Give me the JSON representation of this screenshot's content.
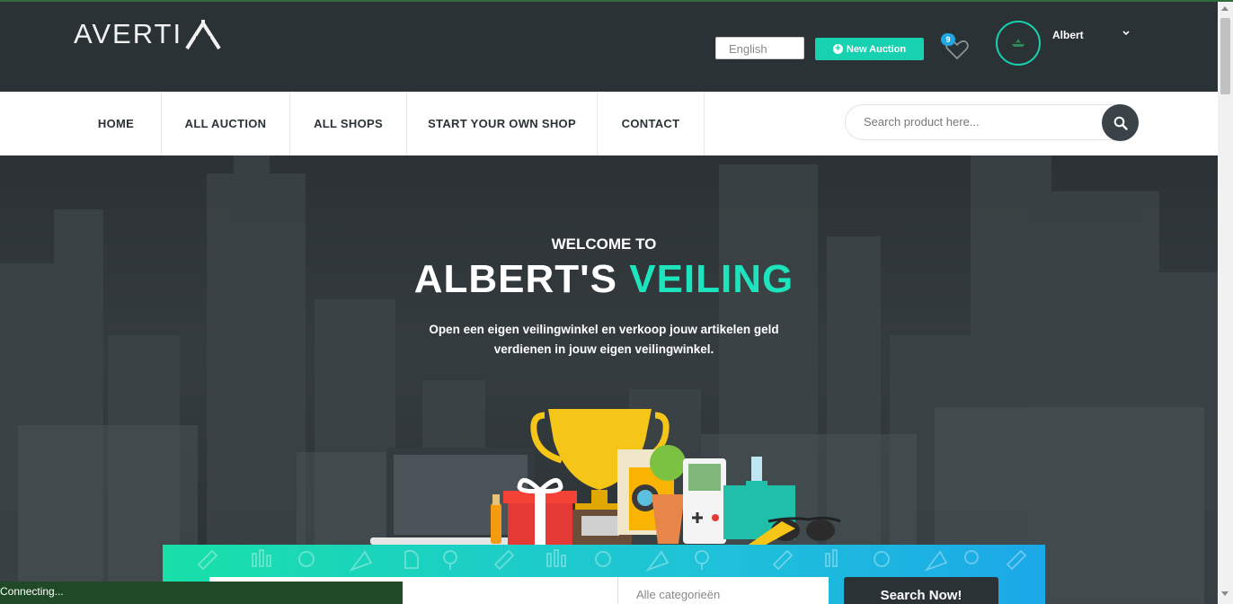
{
  "header": {
    "logo_text": "AVERTI",
    "language": "English",
    "new_auction_label": "New Auction",
    "wishlist_count": "9",
    "user_name": "Albert"
  },
  "nav": {
    "items": [
      "HOME",
      "ALL AUCTION",
      "ALL SHOPS",
      "START YOUR OWN SHOP",
      "CONTACT"
    ],
    "search_placeholder": "Search product here..."
  },
  "hero": {
    "welcome": "WELCOME TO",
    "title_main": "ALBERT'S ",
    "title_accent": "VEILING",
    "subtitle": "Open een eigen veilingwinkel en verkoop jouw artikelen geld verdienen in jouw eigen veilingwinkel."
  },
  "search_band": {
    "category_placeholder": "Alle categorieën",
    "button_label": "Search Now!"
  },
  "status_bar": {
    "text": "Connecting..."
  },
  "colors": {
    "accent": "#17d1b0",
    "header_bg": "#2a3236",
    "badge": "#1ea7e0"
  },
  "icons": [
    "plus-icon",
    "heart-icon",
    "chevron-down-icon",
    "search-icon"
  ]
}
